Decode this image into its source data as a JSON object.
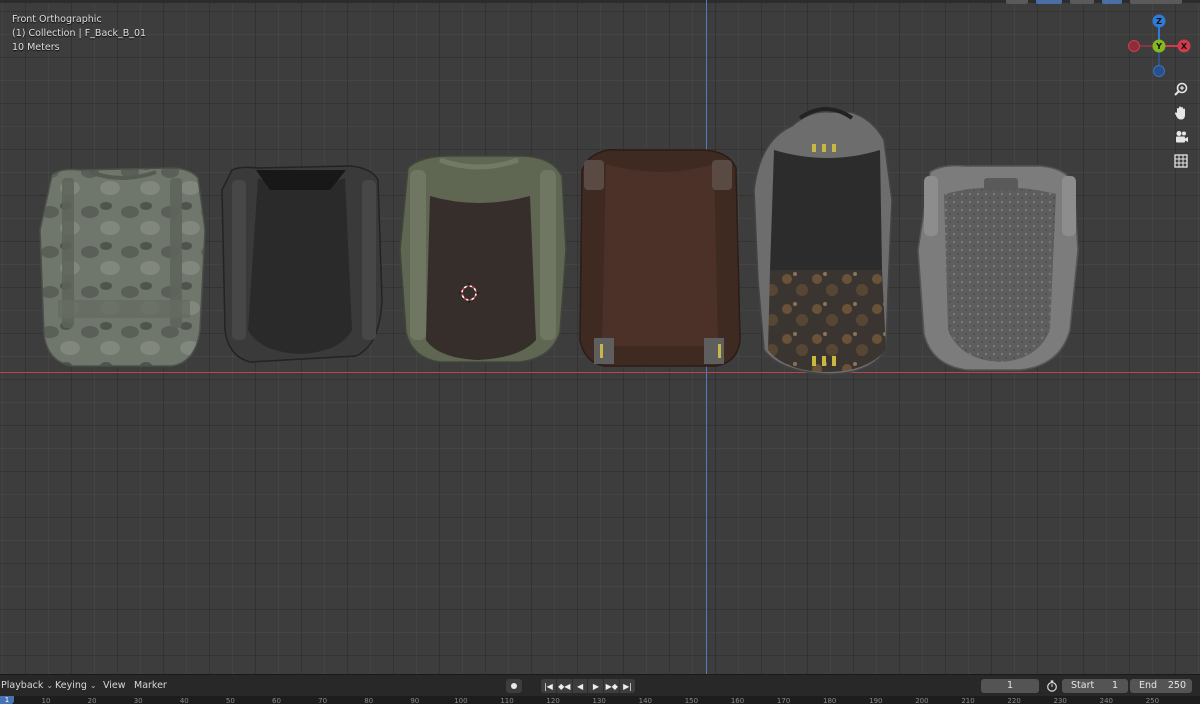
{
  "viewport": {
    "view_name": "Front Orthographic",
    "collection_info": "(1) Collection | F_Back_B_01",
    "scale_label": "10 Meters"
  },
  "gizmo": {
    "z_label": "Z",
    "y_label": "Y",
    "x_label": "X",
    "colors": {
      "x": "#d13a4a",
      "y": "#86b81f",
      "z": "#2f7bd8"
    }
  },
  "nav_buttons": [
    {
      "name": "zoom-icon"
    },
    {
      "name": "pan-hand-icon"
    },
    {
      "name": "camera-view-icon"
    },
    {
      "name": "perspective-grid-icon"
    }
  ],
  "backpacks": [
    {
      "name": "camo-backpack",
      "color": "#6b7166"
    },
    {
      "name": "black-tactical-backpack",
      "color": "#2b2b2b"
    },
    {
      "name": "olive-backpack",
      "color": "#5d6351"
    },
    {
      "name": "brown-leather-backpack",
      "color": "#4a3128"
    },
    {
      "name": "dirty-black-backpack",
      "color": "#2e2e2e"
    },
    {
      "name": "grey-mesh-backpack",
      "color": "#6c6c6c"
    }
  ],
  "timeline": {
    "menus": [
      {
        "label": "Playback",
        "has_dropdown": true
      },
      {
        "label": "Keying",
        "has_dropdown": true
      },
      {
        "label": "View",
        "has_dropdown": false
      },
      {
        "label": "Marker",
        "has_dropdown": false
      }
    ],
    "transport_icons": [
      "jump-start-icon",
      "prev-keyframe-icon",
      "play-reverse-icon",
      "play-icon",
      "next-keyframe-icon",
      "jump-end-icon"
    ],
    "current_frame": "1",
    "start_label": "Start",
    "start_value": "1",
    "end_label": "End",
    "end_value": "250"
  },
  "ruler": {
    "playhead": "1",
    "ticks": [
      "10",
      "20",
      "30",
      "40",
      "50",
      "60",
      "70",
      "80",
      "90",
      "100",
      "110",
      "120",
      "130",
      "140",
      "150",
      "160",
      "170",
      "180",
      "190",
      "200",
      "210",
      "220",
      "230",
      "240",
      "250"
    ]
  }
}
